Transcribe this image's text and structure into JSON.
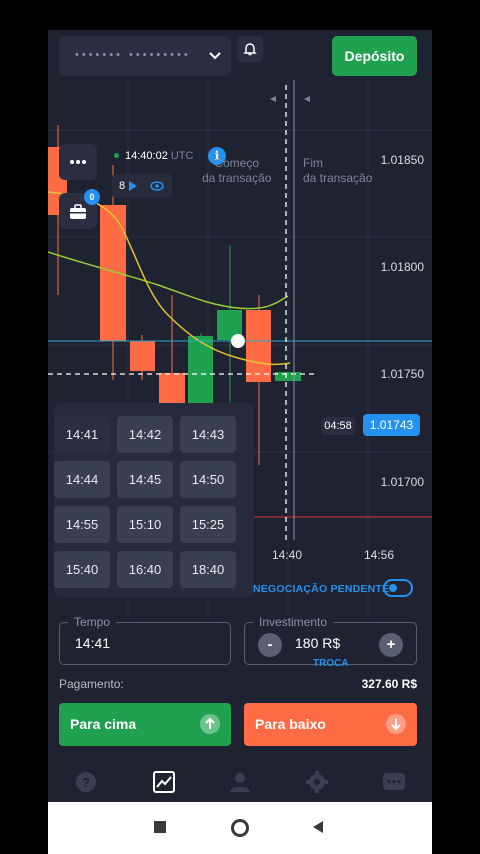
{
  "header": {
    "account_masked": "••••••• •••••••••",
    "deposit_label": "Depósito"
  },
  "chart": {
    "clock_time": "14:40:02",
    "clock_zone": "UTC",
    "indicator_count": "8",
    "portfolio_badge": "0",
    "start_label_line1": "Começo",
    "start_label_line2": "da transação",
    "end_label_line1": "Fim",
    "end_label_line2": "da transação",
    "price_ticks": [
      "1.01850",
      "1.01800",
      "1.01750",
      "1.01700"
    ],
    "time_ticks": [
      "14:40",
      "14:56"
    ],
    "time_left": "04:58",
    "current_price": "1.01743"
  },
  "time_picker": {
    "options": [
      "14:41",
      "14:42",
      "14:43",
      "14:44",
      "14:45",
      "14:50",
      "14:55",
      "15:10",
      "15:25",
      "15:40",
      "16:40",
      "18:40"
    ],
    "selected": "14:41"
  },
  "pending": {
    "label": "NEGOCIAÇÃO PENDENTE"
  },
  "trade": {
    "time_legend": "Tempo",
    "time_value": "14:41",
    "invest_legend": "Investimento",
    "invest_value": "180 R$",
    "minus": "-",
    "plus": "+",
    "swap_label": "TROCA",
    "payout_label": "Pagamento:",
    "payout_value": "327.60 R$",
    "up_label": "Para cima",
    "down_label": "Para baixo"
  },
  "nav": {
    "items": [
      "help-icon",
      "chart-icon",
      "user-icon",
      "settings-icon",
      "chat-icon"
    ]
  },
  "colors": {
    "up": "#1fa14f",
    "down": "#ff6b45",
    "accent": "#2491ee",
    "background": "#1f2231"
  }
}
